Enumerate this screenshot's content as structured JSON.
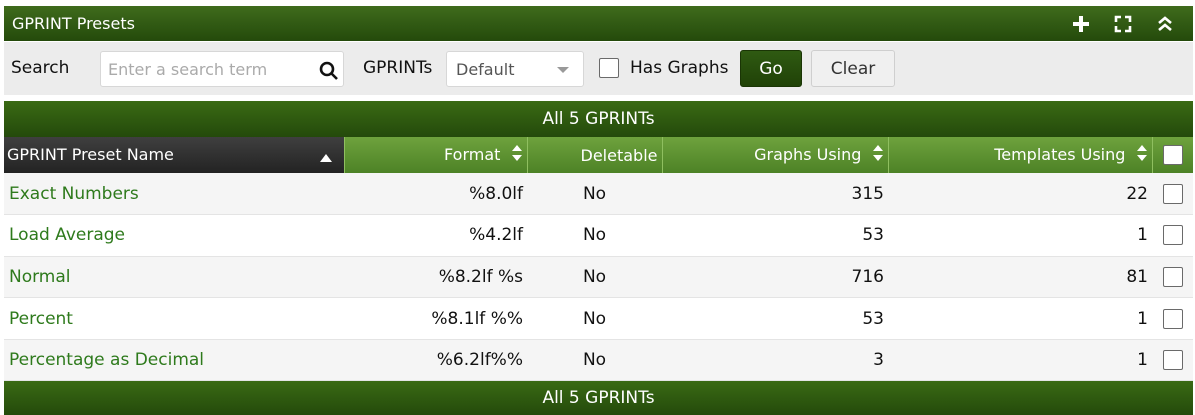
{
  "panel": {
    "title": "GPRINT Presets",
    "tools": [
      {
        "name": "add-icon"
      },
      {
        "name": "fullscreen-icon"
      },
      {
        "name": "collapse-icon"
      }
    ]
  },
  "filter": {
    "search_label": "Search",
    "search_placeholder": "Enter a search term",
    "search_value": "",
    "gprints_label": "GPRINTs",
    "gprints_selected": "Default",
    "has_graphs_label": "Has Graphs",
    "has_graphs_checked": false,
    "go_label": "Go",
    "clear_label": "Clear"
  },
  "nav": {
    "top": "All 5 GPRINTs",
    "bottom": "All 5 GPRINTs"
  },
  "table": {
    "columns": {
      "name": "GPRINT Preset Name",
      "format": "Format",
      "deletable": "Deletable",
      "graphs": "Graphs Using",
      "templates": "Templates Using"
    },
    "rows": [
      {
        "name": "Exact Numbers",
        "format": "%8.0lf",
        "deletable": "No",
        "graphs": "315",
        "templates": "22"
      },
      {
        "name": "Load Average",
        "format": "%4.2lf",
        "deletable": "No",
        "graphs": "53",
        "templates": "1"
      },
      {
        "name": "Normal",
        "format": "%8.2lf %s",
        "deletable": "No",
        "graphs": "716",
        "templates": "81"
      },
      {
        "name": "Percent",
        "format": "%8.1lf %%",
        "deletable": "No",
        "graphs": "53",
        "templates": "1"
      },
      {
        "name": "Percentage as Decimal",
        "format": "%6.2lf%%",
        "deletable": "No",
        "graphs": "3",
        "templates": "1"
      }
    ]
  },
  "colors": {
    "header_green": "#244a0b",
    "column_green": "#5a9130",
    "link_green": "#2e7a1c"
  }
}
